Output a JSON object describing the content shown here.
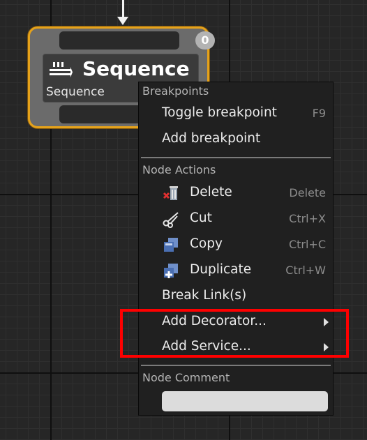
{
  "node": {
    "title": "Sequence",
    "subtitle": "Sequence",
    "badge": "0",
    "icon": "sequence-icon"
  },
  "context_menu": {
    "sections": {
      "breakpoints": "Breakpoints",
      "node_actions": "Node Actions",
      "node_comment": "Node Comment"
    },
    "toggle_breakpoint": {
      "label": "Toggle breakpoint",
      "shortcut": "F9"
    },
    "add_breakpoint": {
      "label": "Add breakpoint"
    },
    "delete": {
      "label": "Delete",
      "shortcut": "Delete",
      "icon": "trash-delete-icon"
    },
    "cut": {
      "label": "Cut",
      "shortcut": "Ctrl+X",
      "icon": "scissors-icon"
    },
    "copy": {
      "label": "Copy",
      "shortcut": "Ctrl+C",
      "icon": "copy-icon"
    },
    "duplicate": {
      "label": "Duplicate",
      "shortcut": "Ctrl+W",
      "icon": "duplicate-icon"
    },
    "break_links": {
      "label": "Break Link(s)"
    },
    "add_decorator": {
      "label": "Add Decorator..."
    },
    "add_service": {
      "label": "Add Service..."
    },
    "comment_value": ""
  },
  "colors": {
    "node_border": "#e5a21b",
    "highlight": "#ff0000",
    "canvas": "#262626"
  }
}
